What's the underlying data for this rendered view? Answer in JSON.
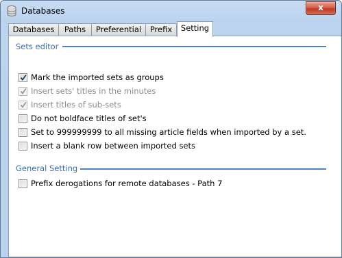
{
  "window": {
    "title": "Databases",
    "close_glyph": "x"
  },
  "tabs": [
    {
      "label": "Databases",
      "active": false
    },
    {
      "label": "Paths",
      "active": false
    },
    {
      "label": "Preferential",
      "active": false
    },
    {
      "label": "Prefix",
      "active": false
    },
    {
      "label": "Setting",
      "active": true
    }
  ],
  "sets_editor": {
    "title": "Sets editor",
    "options": [
      {
        "label": "Mark the imported sets as groups",
        "checked": true,
        "enabled": true
      },
      {
        "label": "Insert sets' titles in the minutes",
        "checked": true,
        "enabled": false
      },
      {
        "label": "Insert titles of sub-sets",
        "checked": true,
        "enabled": false
      },
      {
        "label": "Do not boldface titles of set's",
        "checked": false,
        "enabled": true
      },
      {
        "label": "Set to 999999999 to all missing article fields when imported by a set.",
        "checked": false,
        "enabled": true
      },
      {
        "label": "Insert a blank row between imported sets",
        "checked": false,
        "enabled": true
      }
    ]
  },
  "general_setting": {
    "title": "General Setting",
    "options": [
      {
        "label": "Prefix derogations for remote databases - Path 7",
        "checked": false,
        "enabled": true
      }
    ]
  },
  "colors": {
    "section_title": "#3b6db3",
    "section_line": "#4a82c8",
    "close_button": "#c8432d"
  },
  "icons": {
    "app": "database-icon",
    "close": "close-icon",
    "check": "check-icon"
  }
}
